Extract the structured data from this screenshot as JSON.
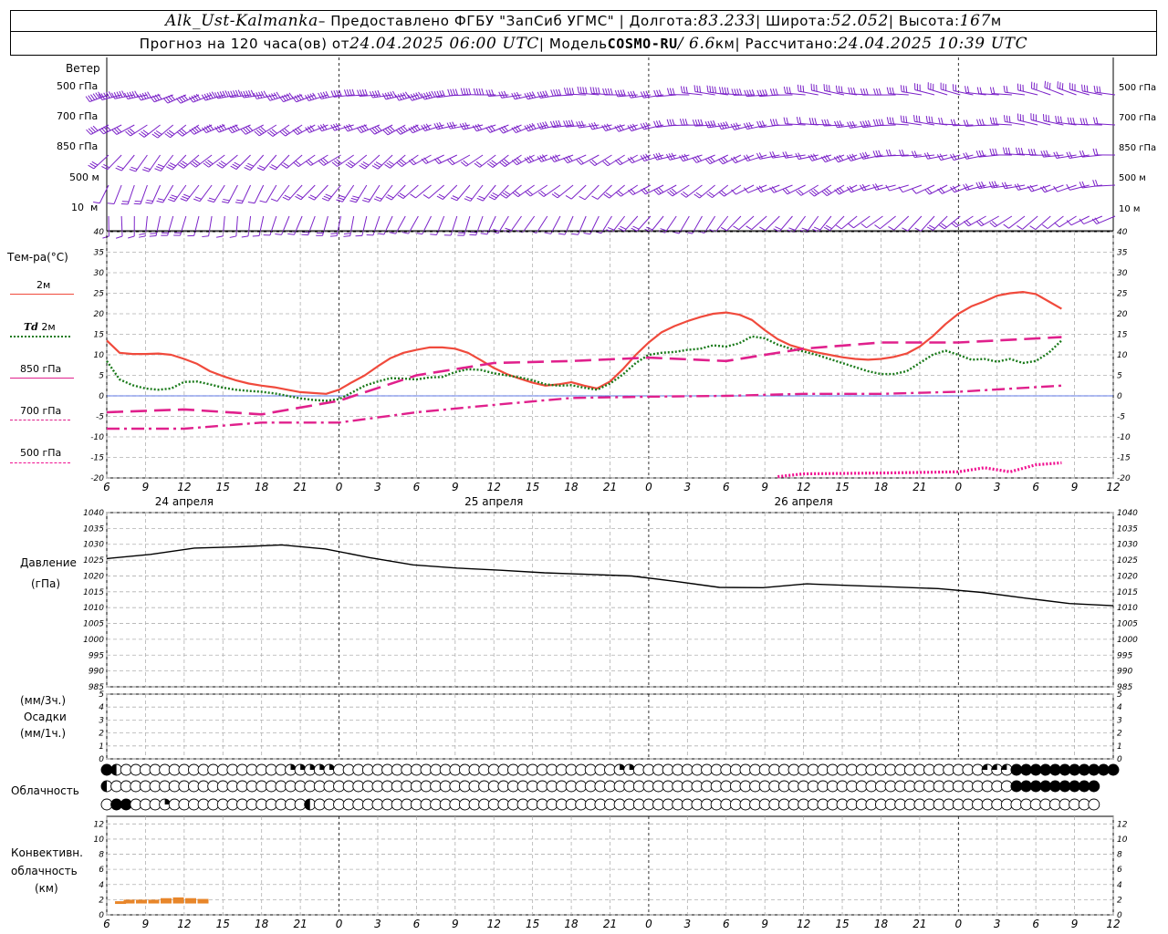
{
  "header": {
    "station": "Alk_Ust-Kalmanka",
    "provider": " – Предоставлено ФГБУ \"ЗапСиб УГМС\" | Долгота: ",
    "lon": "83.233",
    "sep_lat": " | Широта: ",
    "lat": "52.052",
    "sep_alt": " | Высота: ",
    "alt": "167",
    "alt_unit": "м",
    "forecast_prefix": "Прогноз на 120 часа(ов)  от ",
    "start_time": "24.04.2025 06:00 UTC",
    "model_prefix": "  | Модель ",
    "model": "COSMO-RU",
    "model_res": " / 6.6",
    "model_unit": "км",
    "calc_prefix": " | Рассчитано: ",
    "calc_time": "24.04.2025 10:39 UTC"
  },
  "labels": {
    "wind": "Ветер",
    "wind_levels": [
      "500 гПа",
      "700 гПа",
      "850 гПа",
      "500 м",
      "10  м"
    ],
    "temp_title": "Тем-ра(°C)",
    "t2m": "2м",
    "td_a": "Td",
    "td_b": " 2м",
    "t850": "850 гПа",
    "t700": "700 гПа",
    "t500": "500 гПа",
    "pressure": "Давление",
    "pressure_unit": "(гПа)",
    "precip_unit1": "(мм/3ч.)",
    "precip": "Осадки",
    "precip_unit2": "(мм/1ч.)",
    "cloud": "Облачность",
    "conv1": "Конвективн.",
    "conv2": "облачность",
    "conv3": "(км)"
  },
  "colors": {
    "t2m": "#f04a3c",
    "td": "#1a7a1a",
    "t850": "#e0208c",
    "t700": "#e0208c",
    "t500": "#f01090",
    "pressure": "#000000",
    "wind": "#7b22c8",
    "conv": "#e8862a",
    "zero": "#3050e0"
  },
  "chart_data": {
    "time": {
      "start": "24.04.2025 06:00 UTC",
      "end_hour": "26.04.2025 12:00 UTC",
      "tick_labels": [
        "6",
        "9",
        "12",
        "15",
        "18",
        "21",
        "0",
        "3",
        "6",
        "9",
        "12",
        "15",
        "18",
        "21",
        "0",
        "3",
        "6",
        "9",
        "12",
        "15",
        "18",
        "21",
        "0",
        "3",
        "6",
        "9",
        "12"
      ],
      "day_labels": [
        "24 апреля",
        "25 апреля",
        "26 апреля"
      ]
    },
    "temperature": {
      "type": "line",
      "ylim": [
        -20,
        40
      ],
      "yticks": [
        -20,
        -15,
        -10,
        -5,
        0,
        5,
        10,
        15,
        20,
        25,
        30,
        35,
        40
      ],
      "series": [
        {
          "name": "2м",
          "key": "t2m",
          "style": "solid",
          "points": [
            [
              0,
              13.5
            ],
            [
              1,
              10.5
            ],
            [
              2,
              10.2
            ],
            [
              3,
              10.2
            ],
            [
              4,
              10.3
            ],
            [
              5,
              10.0
            ],
            [
              6,
              9.0
            ],
            [
              7,
              7.8
            ],
            [
              8,
              6.0
            ],
            [
              9,
              4.8
            ],
            [
              10,
              3.8
            ],
            [
              11,
              3.0
            ],
            [
              12,
              2.5
            ],
            [
              13,
              2.1
            ],
            [
              14,
              1.5
            ],
            [
              15,
              0.9
            ],
            [
              16,
              0.7
            ],
            [
              17,
              0.5
            ],
            [
              18,
              1.5
            ],
            [
              19,
              3.3
            ],
            [
              20,
              5.0
            ],
            [
              21,
              7.2
            ],
            [
              22,
              9.2
            ],
            [
              23,
              10.5
            ],
            [
              24,
              11.2
            ],
            [
              25,
              11.8
            ],
            [
              26,
              11.8
            ],
            [
              27,
              11.5
            ],
            [
              28,
              10.5
            ],
            [
              29,
              8.7
            ],
            [
              30,
              6.8
            ],
            [
              31,
              5.3
            ],
            [
              32,
              4.2
            ],
            [
              33,
              3.2
            ],
            [
              34,
              2.5
            ],
            [
              35,
              2.8
            ],
            [
              36,
              3.3
            ],
            [
              37,
              2.5
            ],
            [
              38,
              1.8
            ],
            [
              39,
              3.5
            ],
            [
              40,
              6.5
            ],
            [
              41,
              10.0
            ],
            [
              42,
              13.0
            ],
            [
              43,
              15.5
            ],
            [
              44,
              17.0
            ],
            [
              45,
              18.2
            ],
            [
              46,
              19.2
            ],
            [
              47,
              20.0
            ],
            [
              48,
              20.3
            ],
            [
              49,
              19.8
            ],
            [
              50,
              18.5
            ],
            [
              51,
              16.0
            ],
            [
              52,
              13.8
            ],
            [
              53,
              12.3
            ],
            [
              54,
              11.4
            ],
            [
              55,
              10.6
            ],
            [
              56,
              10.0
            ],
            [
              57,
              9.4
            ],
            [
              58,
              9.0
            ],
            [
              59,
              8.8
            ],
            [
              60,
              9.0
            ],
            [
              61,
              9.5
            ],
            [
              62,
              10.3
            ],
            [
              63,
              12.0
            ],
            [
              64,
              14.5
            ],
            [
              65,
              17.5
            ],
            [
              66,
              20.0
            ],
            [
              67,
              21.8
            ],
            [
              68,
              23.0
            ],
            [
              69,
              24.4
            ],
            [
              70,
              25.0
            ],
            [
              71,
              25.3
            ],
            [
              72,
              24.8
            ],
            [
              73,
              23.0
            ],
            [
              74,
              21.2
            ]
          ]
        },
        {
          "name": "Td 2м",
          "key": "td",
          "style": "dotted",
          "points": [
            [
              0,
              8.5
            ],
            [
              1,
              4.0
            ],
            [
              2,
              2.6
            ],
            [
              3,
              1.8
            ],
            [
              4,
              1.5
            ],
            [
              5,
              1.8
            ],
            [
              6,
              3.4
            ],
            [
              7,
              3.5
            ],
            [
              8,
              2.8
            ],
            [
              9,
              2.0
            ],
            [
              10,
              1.5
            ],
            [
              11,
              1.2
            ],
            [
              12,
              1.0
            ],
            [
              13,
              0.6
            ],
            [
              14,
              0.0
            ],
            [
              15,
              -0.6
            ],
            [
              16,
              -1.0
            ],
            [
              17,
              -1.2
            ],
            [
              18,
              -0.8
            ],
            [
              19,
              0.8
            ],
            [
              20,
              2.5
            ],
            [
              21,
              3.5
            ],
            [
              22,
              4.3
            ],
            [
              23,
              4.2
            ],
            [
              24,
              4.0
            ],
            [
              25,
              4.5
            ],
            [
              26,
              4.6
            ],
            [
              27,
              5.8
            ],
            [
              28,
              6.5
            ],
            [
              29,
              6.3
            ],
            [
              30,
              5.5
            ],
            [
              31,
              5.0
            ],
            [
              32,
              4.5
            ],
            [
              33,
              3.8
            ],
            [
              34,
              2.8
            ],
            [
              35,
              2.5
            ],
            [
              36,
              2.6
            ],
            [
              37,
              2.0
            ],
            [
              38,
              1.5
            ],
            [
              39,
              3.0
            ],
            [
              40,
              5.2
            ],
            [
              41,
              8.0
            ],
            [
              42,
              10.0
            ],
            [
              43,
              10.5
            ],
            [
              44,
              10.7
            ],
            [
              45,
              11.2
            ],
            [
              46,
              11.5
            ],
            [
              47,
              12.3
            ],
            [
              48,
              12.0
            ],
            [
              49,
              12.8
            ],
            [
              50,
              14.5
            ],
            [
              51,
              14.0
            ],
            [
              52,
              12.5
            ],
            [
              53,
              11.5
            ],
            [
              54,
              10.8
            ],
            [
              55,
              10.0
            ],
            [
              56,
              9.0
            ],
            [
              57,
              8.0
            ],
            [
              58,
              7.0
            ],
            [
              59,
              6.0
            ],
            [
              60,
              5.3
            ],
            [
              61,
              5.3
            ],
            [
              62,
              6.0
            ],
            [
              63,
              8.0
            ],
            [
              64,
              10.0
            ],
            [
              65,
              11.0
            ],
            [
              66,
              10.0
            ],
            [
              67,
              8.8
            ],
            [
              68,
              9.0
            ],
            [
              69,
              8.3
            ],
            [
              70,
              9.0
            ],
            [
              71,
              8.0
            ],
            [
              72,
              8.5
            ],
            [
              73,
              10.5
            ],
            [
              74,
              13.5
            ]
          ]
        },
        {
          "name": "850 гПа",
          "key": "t850",
          "style": "longdash",
          "points": [
            [
              0,
              -4.0
            ],
            [
              6,
              -3.3
            ],
            [
              12,
              -4.5
            ],
            [
              18,
              -1.2
            ],
            [
              24,
              5.0
            ],
            [
              30,
              8.0
            ],
            [
              36,
              8.5
            ],
            [
              42,
              9.3
            ],
            [
              48,
              8.5
            ],
            [
              54,
              11.5
            ],
            [
              60,
              13.0
            ],
            [
              66,
              13.0
            ],
            [
              74,
              14.3
            ]
          ]
        },
        {
          "name": "700 гПа",
          "key": "t700",
          "style": "dashdot",
          "points": [
            [
              0,
              -8.0
            ],
            [
              6,
              -8.0
            ],
            [
              12,
              -6.5
            ],
            [
              18,
              -6.5
            ],
            [
              24,
              -4.0
            ],
            [
              30,
              -2.2
            ],
            [
              36,
              -0.5
            ],
            [
              42,
              -0.2
            ],
            [
              48,
              0.0
            ],
            [
              54,
              0.5
            ],
            [
              60,
              0.5
            ],
            [
              66,
              1.0
            ],
            [
              74,
              2.5
            ]
          ]
        },
        {
          "name": "500 гПа",
          "key": "t500",
          "style": "dotted",
          "points": [
            [
              52,
              -19.7
            ],
            [
              54,
              -19.0
            ],
            [
              60,
              -18.8
            ],
            [
              66,
              -18.5
            ],
            [
              68,
              -17.5
            ],
            [
              70,
              -18.5
            ],
            [
              72,
              -16.8
            ],
            [
              74,
              -16.3
            ]
          ]
        }
      ]
    },
    "pressure": {
      "type": "line",
      "ylim": [
        985,
        1040
      ],
      "yticks": [
        985,
        990,
        995,
        1000,
        1005,
        1010,
        1015,
        1020,
        1025,
        1030,
        1035,
        1040
      ],
      "points": [
        [
          0,
          1025.5
        ],
        [
          6,
          1026.8
        ],
        [
          12,
          1028.8
        ],
        [
          18,
          1029.2
        ],
        [
          24,
          1029.8
        ],
        [
          30,
          1028.5
        ],
        [
          36,
          1025.8
        ],
        [
          42,
          1023.5
        ],
        [
          48,
          1022.5
        ],
        [
          54,
          1021.8
        ],
        [
          60,
          1021.0
        ],
        [
          66,
          1020.5
        ],
        [
          72,
          1020.0
        ],
        [
          78,
          1018.3
        ],
        [
          84,
          1016.4
        ],
        [
          90,
          1016.3
        ],
        [
          96,
          1017.5
        ],
        [
          102,
          1017.0
        ],
        [
          108,
          1016.5
        ],
        [
          114,
          1016.0
        ],
        [
          120,
          1014.8
        ],
        [
          126,
          1013.0
        ],
        [
          132,
          1011.3
        ],
        [
          138,
          1010.6
        ]
      ]
    },
    "precipitation": {
      "type": "bar",
      "ylim": [
        0,
        5
      ],
      "yticks": [
        0,
        1,
        2,
        3,
        4,
        5
      ],
      "values": []
    },
    "convective_cloud": {
      "type": "bar",
      "ylim": [
        0,
        13
      ],
      "yticks": [
        0,
        2,
        4,
        6,
        8,
        10,
        12
      ],
      "bars": [
        [
          0.3,
          1.8
        ],
        [
          1,
          2.0
        ],
        [
          2,
          2.0
        ],
        [
          3,
          2.0
        ],
        [
          4,
          2.2
        ],
        [
          5,
          2.3
        ],
        [
          6,
          2.2
        ],
        [
          7,
          2.1
        ]
      ]
    },
    "cloud_cover": {
      "rows": [
        "fhooooooooooooooooosssssooooooooooooooooooooooooooooossooooooooooooooooooooooooooooooooooooqqqfffffffffff",
        "hooooooooooooooooooooooooooooooooooooooooooooooooooooooooooooooooooooooooooooooooooooooooooooofffffffff",
        "offooosoooooooooooooohooooooooooooooooooooooooooooooooooooooooooooooooooooooooooooooooooooooooooooooooo"
      ]
    },
    "wind": {
      "levels": [
        "500 гПа",
        "700 гПа",
        "850 гПа",
        "500 м",
        "10 м"
      ]
    }
  }
}
